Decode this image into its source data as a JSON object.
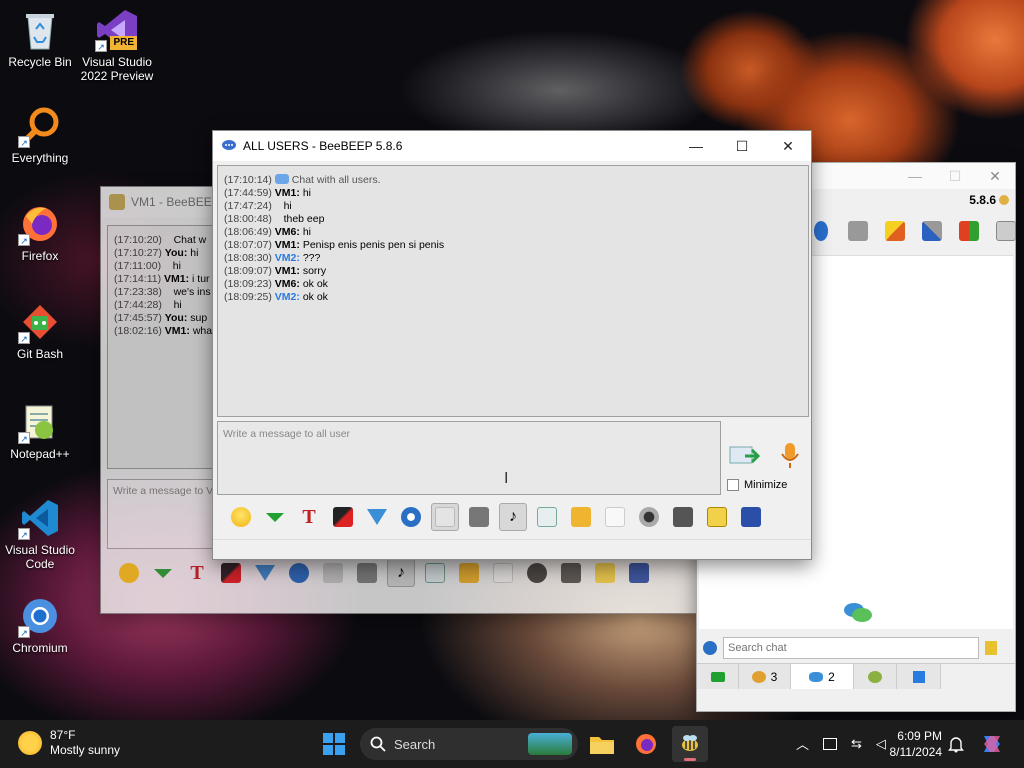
{
  "desktop": {
    "icons": [
      {
        "label": "Recycle Bin"
      },
      {
        "label": "Visual Studio 2022 Preview",
        "badge": "PRE"
      },
      {
        "label": "Everything"
      },
      {
        "label": "Firefox"
      },
      {
        "label": "Git Bash"
      },
      {
        "label": "Notepad++"
      },
      {
        "label": "Visual Studio Code"
      },
      {
        "label": "Chromium"
      }
    ]
  },
  "main_window": {
    "title": "ALL USERS - BeeBEEP 5.8.6",
    "messages": [
      {
        "time": "(17:10:14)",
        "who": "",
        "text": "Chat with all users.",
        "system": true
      },
      {
        "time": "(17:44:59)",
        "who": "VM1:",
        "text": "hi"
      },
      {
        "time": "(17:47:24)",
        "who": "",
        "text": "hi"
      },
      {
        "time": "(18:00:48)",
        "who": "",
        "text": "theb eep"
      },
      {
        "time": "(18:06:49)",
        "who": "VM6:",
        "text": "hi"
      },
      {
        "time": "(18:07:07)",
        "who": "VM1:",
        "text": "Penisp enis penis pen si penis"
      },
      {
        "time": "(18:08:30)",
        "who": "VM2:",
        "text": "???",
        "blue": true
      },
      {
        "time": "(18:09:07)",
        "who": "VM1:",
        "text": "sorry"
      },
      {
        "time": "(18:09:23)",
        "who": "VM6:",
        "text": "ok ok"
      },
      {
        "time": "(18:09:25)",
        "who": "VM2:",
        "text": "ok ok",
        "blue": true
      }
    ],
    "input_placeholder": "Write a message to all user",
    "minimize_label": "Minimize"
  },
  "back_window": {
    "title": "VM1 - BeeBEEP",
    "messages": [
      {
        "time": "(17:10:20)",
        "who": "",
        "text": "Chat w"
      },
      {
        "time": "(17:10:27)",
        "who": "You:",
        "text": "hi"
      },
      {
        "time": "(17:11:00)",
        "who": "",
        "text": "hi"
      },
      {
        "time": "(17:14:11)",
        "who": "VM1:",
        "text": "i tur"
      },
      {
        "time": "(17:23:38)",
        "who": "",
        "text": "we's ins"
      },
      {
        "time": "(17:44:28)",
        "who": "",
        "text": "hi"
      },
      {
        "time": "(17:45:57)",
        "who": "You:",
        "text": "sup"
      },
      {
        "time": "(18:02:16)",
        "who": "VM1:",
        "text": "wha"
      }
    ],
    "input_placeholder": "Write a message to V"
  },
  "right_window": {
    "version": "5.8.6",
    "search_placeholder": "Search chat",
    "tabs": [
      {
        "label": ""
      },
      {
        "label": "3"
      },
      {
        "label": "2"
      },
      {
        "label": ""
      },
      {
        "label": ""
      }
    ]
  },
  "taskbar": {
    "weather_temp": "87°F",
    "weather_desc": "Mostly sunny",
    "search_label": "Search",
    "time": "6:09 PM",
    "date": "8/11/2024"
  },
  "colors": {
    "accent_blue": "#2a7be0",
    "taskbar_bg": "#1c1c1c"
  }
}
